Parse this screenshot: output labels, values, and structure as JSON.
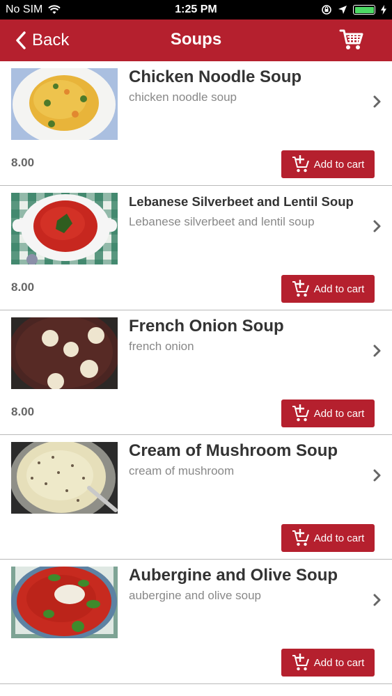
{
  "status_bar": {
    "carrier": "No SIM",
    "time": "1:25 PM"
  },
  "nav": {
    "back_label": "Back",
    "title": "Soups"
  },
  "colors": {
    "brand": "#b5202e",
    "battery": "#4cd964"
  },
  "items": [
    {
      "title": "Chicken Noodle Soup",
      "description": "chicken noodle soup",
      "price": "8.00",
      "button": "Add to cart"
    },
    {
      "title": "Lebanese Silverbeet and Lentil Soup",
      "description": "Lebanese silverbeet and lentil soup",
      "price": "8.00",
      "button": "Add to cart"
    },
    {
      "title": "French Onion Soup",
      "description": "french onion",
      "price": "8.00",
      "button": "Add to cart"
    },
    {
      "title": "Cream of Mushroom Soup",
      "description": "cream of mushroom",
      "price": "",
      "button": "Add to cart"
    },
    {
      "title": "Aubergine and Olive Soup",
      "description": "aubergine and olive soup",
      "price": "",
      "button": "Add to cart"
    }
  ]
}
